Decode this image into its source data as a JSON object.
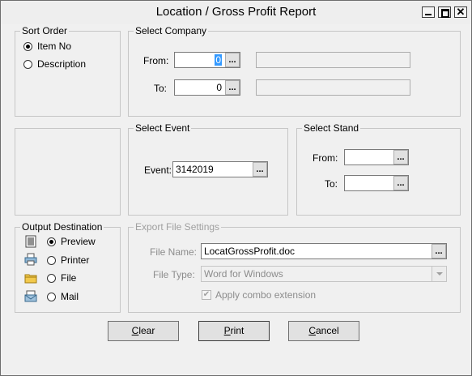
{
  "window": {
    "title": "Location / Gross Profit Report"
  },
  "sort_order": {
    "label": "Sort Order",
    "options": [
      {
        "label": "Item No",
        "selected": true
      },
      {
        "label": "Description",
        "selected": false
      }
    ]
  },
  "select_company": {
    "label": "Select Company",
    "from_label": "From:",
    "from_value": "0",
    "to_label": "To:",
    "to_value": "0",
    "from_name": "",
    "to_name": ""
  },
  "select_event": {
    "label": "Select Event",
    "event_label": "Event:",
    "event_value": "3142019"
  },
  "select_stand": {
    "label": "Select Stand",
    "from_label": "From:",
    "from_value": "",
    "to_label": "To:",
    "to_value": ""
  },
  "output_destination": {
    "label": "Output Destination",
    "options": [
      {
        "label": "Preview",
        "selected": true,
        "icon": "preview-icon"
      },
      {
        "label": "Printer",
        "selected": false,
        "icon": "printer-icon"
      },
      {
        "label": "File",
        "selected": false,
        "icon": "folder-icon"
      },
      {
        "label": "Mail",
        "selected": false,
        "icon": "mail-icon"
      }
    ]
  },
  "export_settings": {
    "label": "Export  File Settings",
    "file_name_label": "File Name:",
    "file_name_value": "LocatGrossProfit.doc",
    "file_type_label": "File Type:",
    "file_type_value": "Word for Windows",
    "apply_combo_label": "Apply combo extension",
    "apply_combo_checked": true
  },
  "buttons": {
    "ellipsis": "...",
    "clear_prefix": "C",
    "clear_rest": "lear",
    "print_prefix": "P",
    "print_rest": "rint",
    "cancel_prefix": "C",
    "cancel_rest": "ancel"
  },
  "colors": {
    "window_bg": "#f0f0f0",
    "selection": "#3399ff"
  }
}
